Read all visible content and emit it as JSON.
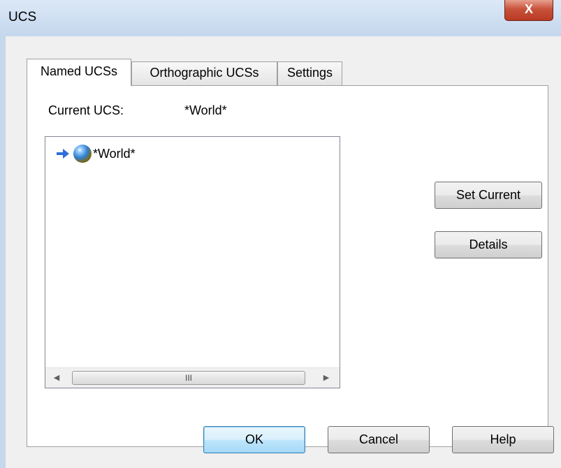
{
  "window": {
    "title": "UCS",
    "close_glyph": "X"
  },
  "tabs": [
    {
      "label": "Named UCSs",
      "active": true
    },
    {
      "label": "Orthographic UCSs",
      "active": false
    },
    {
      "label": "Settings",
      "active": false
    }
  ],
  "current_ucs": {
    "label": "Current UCS:",
    "value": "*World*"
  },
  "ucs_list": {
    "items": [
      {
        "name": "*World*",
        "icons": [
          "current-arrow-icon",
          "globe-icon"
        ],
        "current": true
      }
    ],
    "scrollbar": {
      "left_glyph": "◀",
      "thumb_glyph": "III",
      "right_glyph": "▶"
    }
  },
  "side_buttons": {
    "set_current": "Set Current",
    "details": "Details"
  },
  "footer_buttons": {
    "ok": "OK",
    "cancel": "Cancel",
    "help": "Help"
  },
  "colors": {
    "accent_arrow": "#2f6fd8",
    "close_button": "#c9523a",
    "default_button_border": "#3c7fb1"
  }
}
